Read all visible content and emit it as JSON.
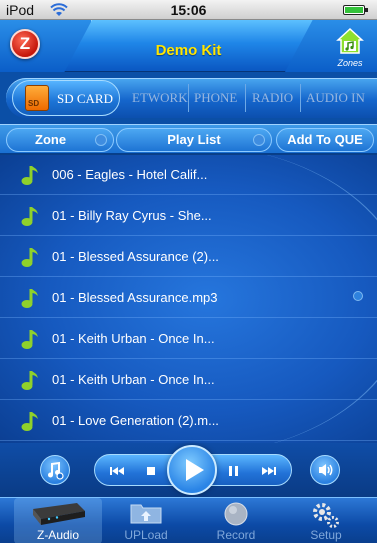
{
  "status_bar": {
    "carrier": "iPod",
    "time": "15:06"
  },
  "header": {
    "title": "Demo Kit",
    "logo_letter": "Z",
    "zones_label": "Zones"
  },
  "sources": {
    "active": {
      "label": "SD CARD",
      "icon_text": "SD"
    },
    "tabs": [
      "ETWORK",
      "PHONE",
      "RADIO",
      "AUDIO IN"
    ]
  },
  "action_bar": {
    "zone_label": "Zone",
    "playlist_label": "Play List",
    "add_label": "Add To QUE"
  },
  "tracks": [
    "006 - Eagles - Hotel Calif...",
    "01 - Billy Ray Cyrus - She...",
    "01 - Blessed Assurance (2)...",
    "01 - Blessed Assurance.mp3",
    "01 - Keith Urban - Once In...",
    "01 - Keith Urban - Once In...",
    "01 - Love Generation (2).m..."
  ],
  "transport": {
    "icons": [
      "music-settings-icon",
      "previous-icon",
      "stop-icon",
      "play-icon",
      "pause-icon",
      "next-icon",
      "volume-icon"
    ]
  },
  "bottom_nav": [
    {
      "label": "Z-Audio",
      "active": true
    },
    {
      "label": "UPLoad",
      "active": false
    },
    {
      "label": "Record",
      "active": false
    },
    {
      "label": "Setup",
      "active": false
    }
  ],
  "colors": {
    "title": "#ffe600",
    "accent": "#1f86e8",
    "background": "#0a3f86",
    "note": "#8fd12b"
  }
}
